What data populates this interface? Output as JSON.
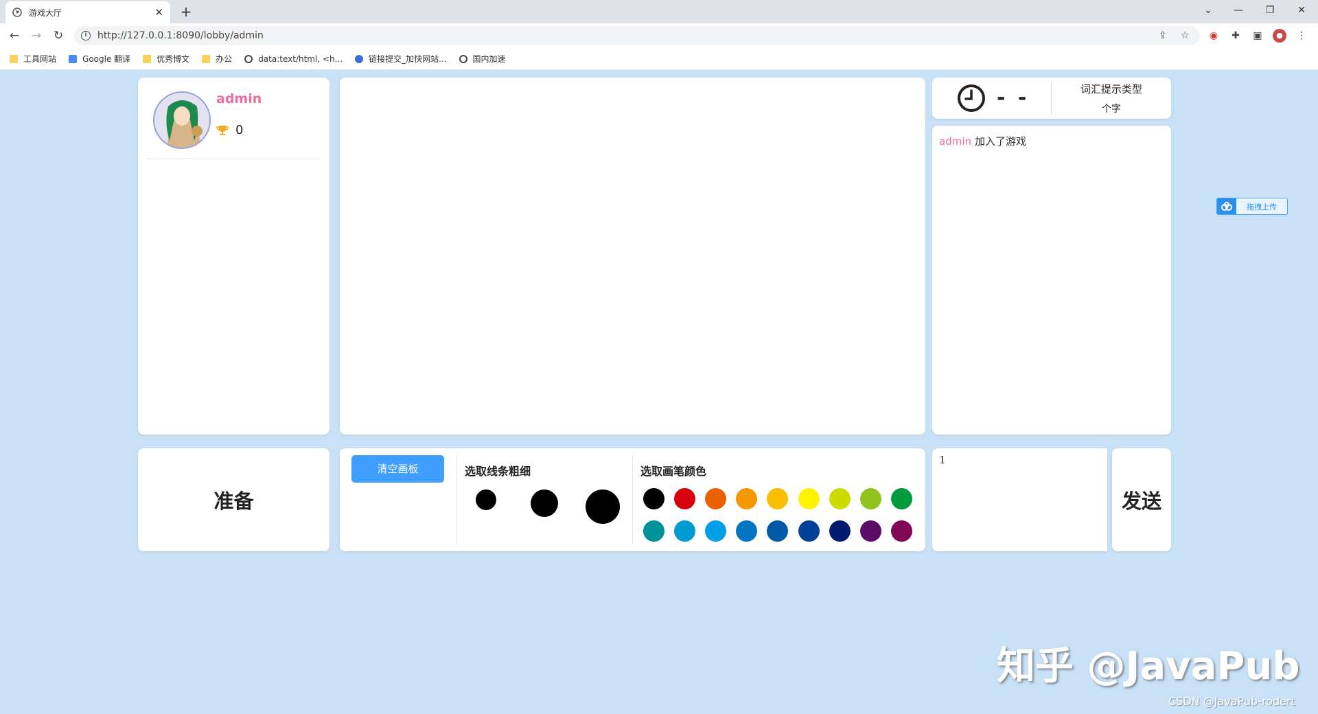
{
  "browser": {
    "tab_title": "游戏大厅",
    "tab_close": "✕",
    "new_tab": "+",
    "url": "http://127.0.0.1:8090/lobby/admin",
    "bookmarks": [
      {
        "label": "工具网站",
        "icon": "folder-icon"
      },
      {
        "label": "Google 翻译",
        "icon": "google-translate-icon"
      },
      {
        "label": "优秀博文",
        "icon": "folder-icon"
      },
      {
        "label": "办公",
        "icon": "folder-icon"
      },
      {
        "label": "data:text/html, <h...",
        "icon": "globe-icon"
      },
      {
        "label": "链接提交_加快网站...",
        "icon": "paw-icon"
      },
      {
        "label": "国内加速",
        "icon": "globe-icon"
      }
    ]
  },
  "player": {
    "name": "admin",
    "score": "0"
  },
  "game": {
    "timer": "- -",
    "hint_title": "词汇提示类型",
    "hint_value": "个字"
  },
  "chat": {
    "messages": [
      {
        "user": "admin",
        "text": "加入了游戏"
      }
    ],
    "input_value": "1",
    "send_label": "发送"
  },
  "controls": {
    "ready_label": "准备",
    "clear_label": "清空画板",
    "line_width_label": "选取线条粗细",
    "color_label": "选取画笔颜色",
    "colors_row1": [
      "#000000",
      "#d7000f",
      "#eb6100",
      "#f39800",
      "#fabe00",
      "#fff100",
      "#cfdb00",
      "#8fc31f",
      "#009a3e"
    ],
    "colors_row2": [
      "#009199",
      "#0099d0",
      "#00a0e9",
      "#0075c2",
      "#005aa5",
      "#004098",
      "#001c6e",
      "#5a0c66",
      "#7f0755"
    ]
  },
  "widgets": {
    "upload_label": "拖拽上传"
  },
  "watermark": {
    "main": "知乎 @JavaPub",
    "sub": "CSDN @JavaPub-rodert"
  }
}
